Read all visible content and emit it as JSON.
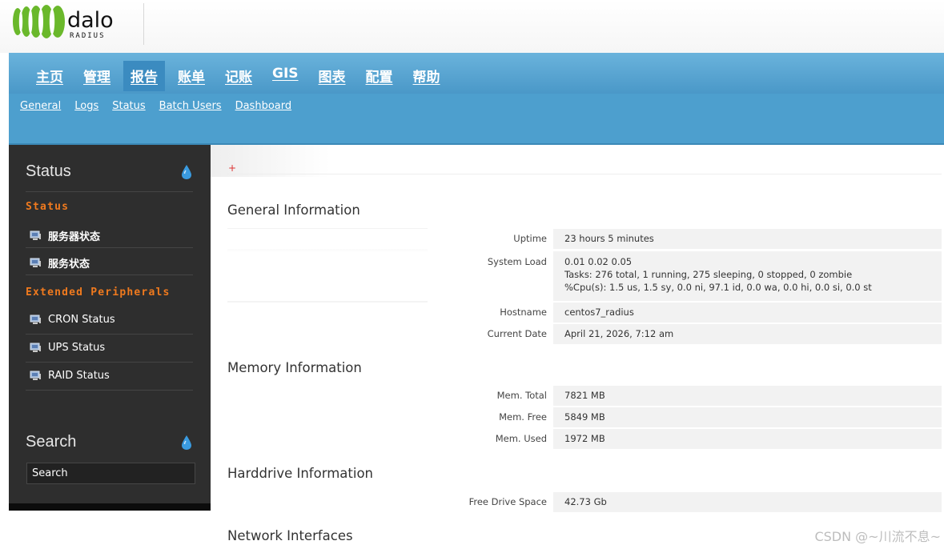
{
  "logo": {
    "word": "dalo",
    "sub": "RADIUS"
  },
  "nav": {
    "main_items": [
      "主页",
      "管理",
      "报告",
      "账单",
      "记账",
      "GIS",
      "图表",
      "配置",
      "帮助"
    ],
    "active_index": 2,
    "sub_items": [
      "General",
      "Logs",
      "Status",
      "Batch Users",
      "Dashboard"
    ]
  },
  "sidebar": {
    "heading": "Status",
    "section_status": "Status",
    "status_items": [
      "服务器状态",
      "服务状态"
    ],
    "section_extended": "Extended Peripherals",
    "extended_items": [
      "CRON Status",
      "UPS Status",
      "RAID Status"
    ],
    "search_heading": "Search",
    "search_placeholder": "Search"
  },
  "content": {
    "plus": "+",
    "general": {
      "title": "General Information",
      "uptime_label": "Uptime",
      "uptime_value": "23 hours 5 minutes",
      "load_label": "System Load",
      "load_line1": "0.01 0.02 0.05",
      "load_line2": "Tasks: 276 total, 1 running, 275 sleeping, 0 stopped, 0 zombie",
      "load_line3": "%Cpu(s): 1.5 us, 1.5 sy, 0.0 ni, 97.1 id, 0.0 wa, 0.0 hi, 0.0 si, 0.0 st",
      "hostname_label": "Hostname",
      "hostname_value": "centos7_radius",
      "date_label": "Current Date",
      "date_value": "April 21, 2026, 7:12 am"
    },
    "memory": {
      "title": "Memory Information",
      "total_label": "Mem. Total",
      "total_value": "7821 MB",
      "free_label": "Mem. Free",
      "free_value": "5849 MB",
      "used_label": "Mem. Used",
      "used_value": "1972 MB"
    },
    "harddrive": {
      "title": "Harddrive Information",
      "free_label": "Free Drive Space",
      "free_value": "42.73 Gb"
    },
    "network": {
      "title": "Network Interfaces"
    }
  },
  "watermark": "CSDN @~川流不息~",
  "colors": {
    "nav": "#4d9fce",
    "sidebar": "#2e2e2e",
    "section_accent": "#f07a1e",
    "drop_icon": "#3a9be0"
  }
}
